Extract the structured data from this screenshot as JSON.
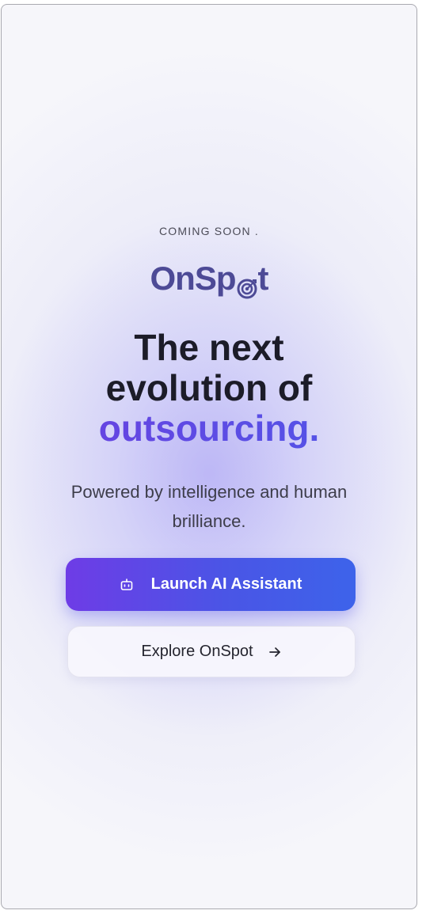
{
  "hero": {
    "eyebrow": "COMING SOON .",
    "brand": {
      "prefix": "OnSp",
      "suffix": "t",
      "color": "#4d4a96"
    },
    "headline_line1": "The next",
    "headline_line2": "evolution of",
    "headline_accent": "outsourcing.",
    "subtext": "Powered by intelligence and human brilliance."
  },
  "actions": {
    "primary_label": "Launch AI Assistant",
    "primary_icon": "robot-icon",
    "secondary_label": "Explore OnSpot",
    "secondary_icon": "arrow-right-icon"
  },
  "colors": {
    "accent_start": "#6e3ce6",
    "accent_end": "#3d63ea",
    "text_dark": "#1c1c28"
  }
}
